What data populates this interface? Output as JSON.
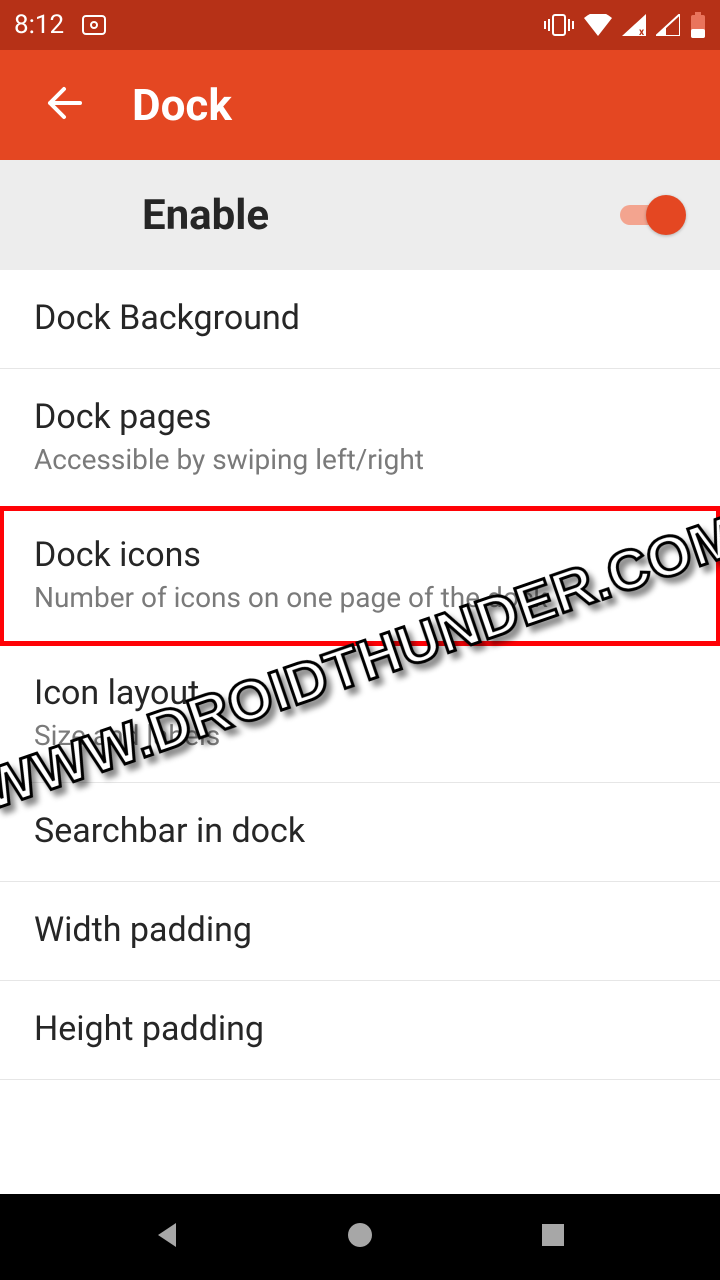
{
  "statusbar": {
    "time": "8:12"
  },
  "appbar": {
    "title": "Dock"
  },
  "enable": {
    "label": "Enable",
    "on": true
  },
  "items": [
    {
      "title": "Dock Background",
      "subtitle": ""
    },
    {
      "title": "Dock pages",
      "subtitle": "Accessible by swiping left/right"
    },
    {
      "title": "Dock icons",
      "subtitle": "Number of icons on one page of the dock",
      "highlight": true
    },
    {
      "title": "Icon layout",
      "subtitle": "Size and labels"
    },
    {
      "title": "Searchbar in dock",
      "subtitle": ""
    },
    {
      "title": "Width padding",
      "subtitle": ""
    },
    {
      "title": "Height padding",
      "subtitle": ""
    }
  ],
  "watermark": "WWW.DROIDTHUNDER.COM",
  "colors": {
    "accent": "#e44722",
    "accentDark": "#b63117",
    "highlight": "#ff0206"
  }
}
